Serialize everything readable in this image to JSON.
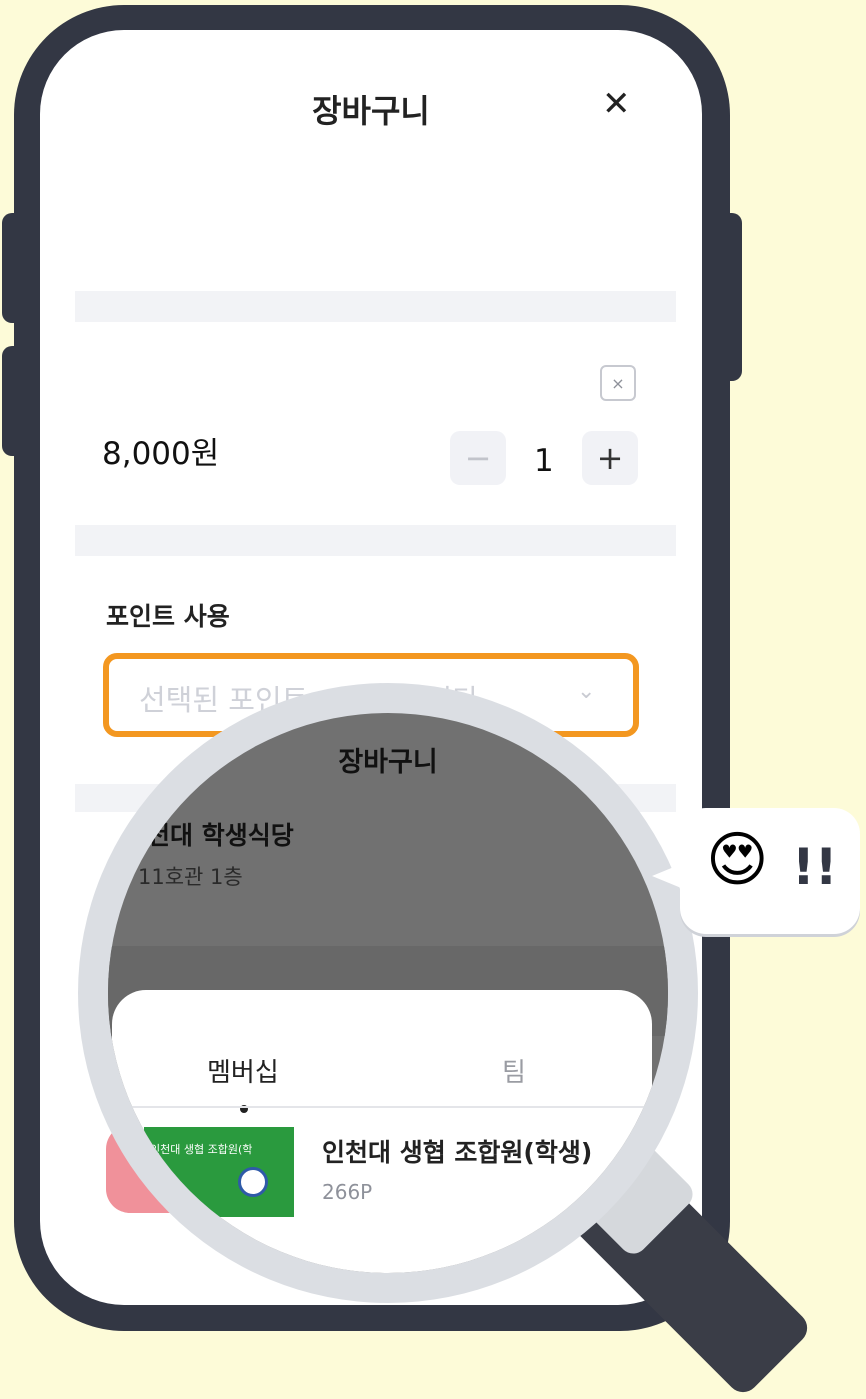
{
  "header": {
    "title": "장바구니",
    "close_icon": "close-icon"
  },
  "cart_item": {
    "price": "8,000원",
    "quantity": "1",
    "minus": "−",
    "plus": "+",
    "remove": "×"
  },
  "points": {
    "label": "포인트 사용",
    "placeholder": "선택된 포인트",
    "placeholder_tail": "습니다.",
    "highlight_color": "#f39720"
  },
  "magnifier": {
    "title": "장바구니",
    "store_name": "인천대 학생식당",
    "store_location": "11호관 1층",
    "tabs": [
      "멤버십",
      "팀"
    ],
    "card": {
      "image_text": "인천대 생협 조합원(학",
      "name": "인천대 생협 조합원(학생)",
      "points": "266P",
      "color": "#2a9a3e"
    }
  },
  "reaction": {
    "emoji": "😍",
    "text": "!!"
  }
}
